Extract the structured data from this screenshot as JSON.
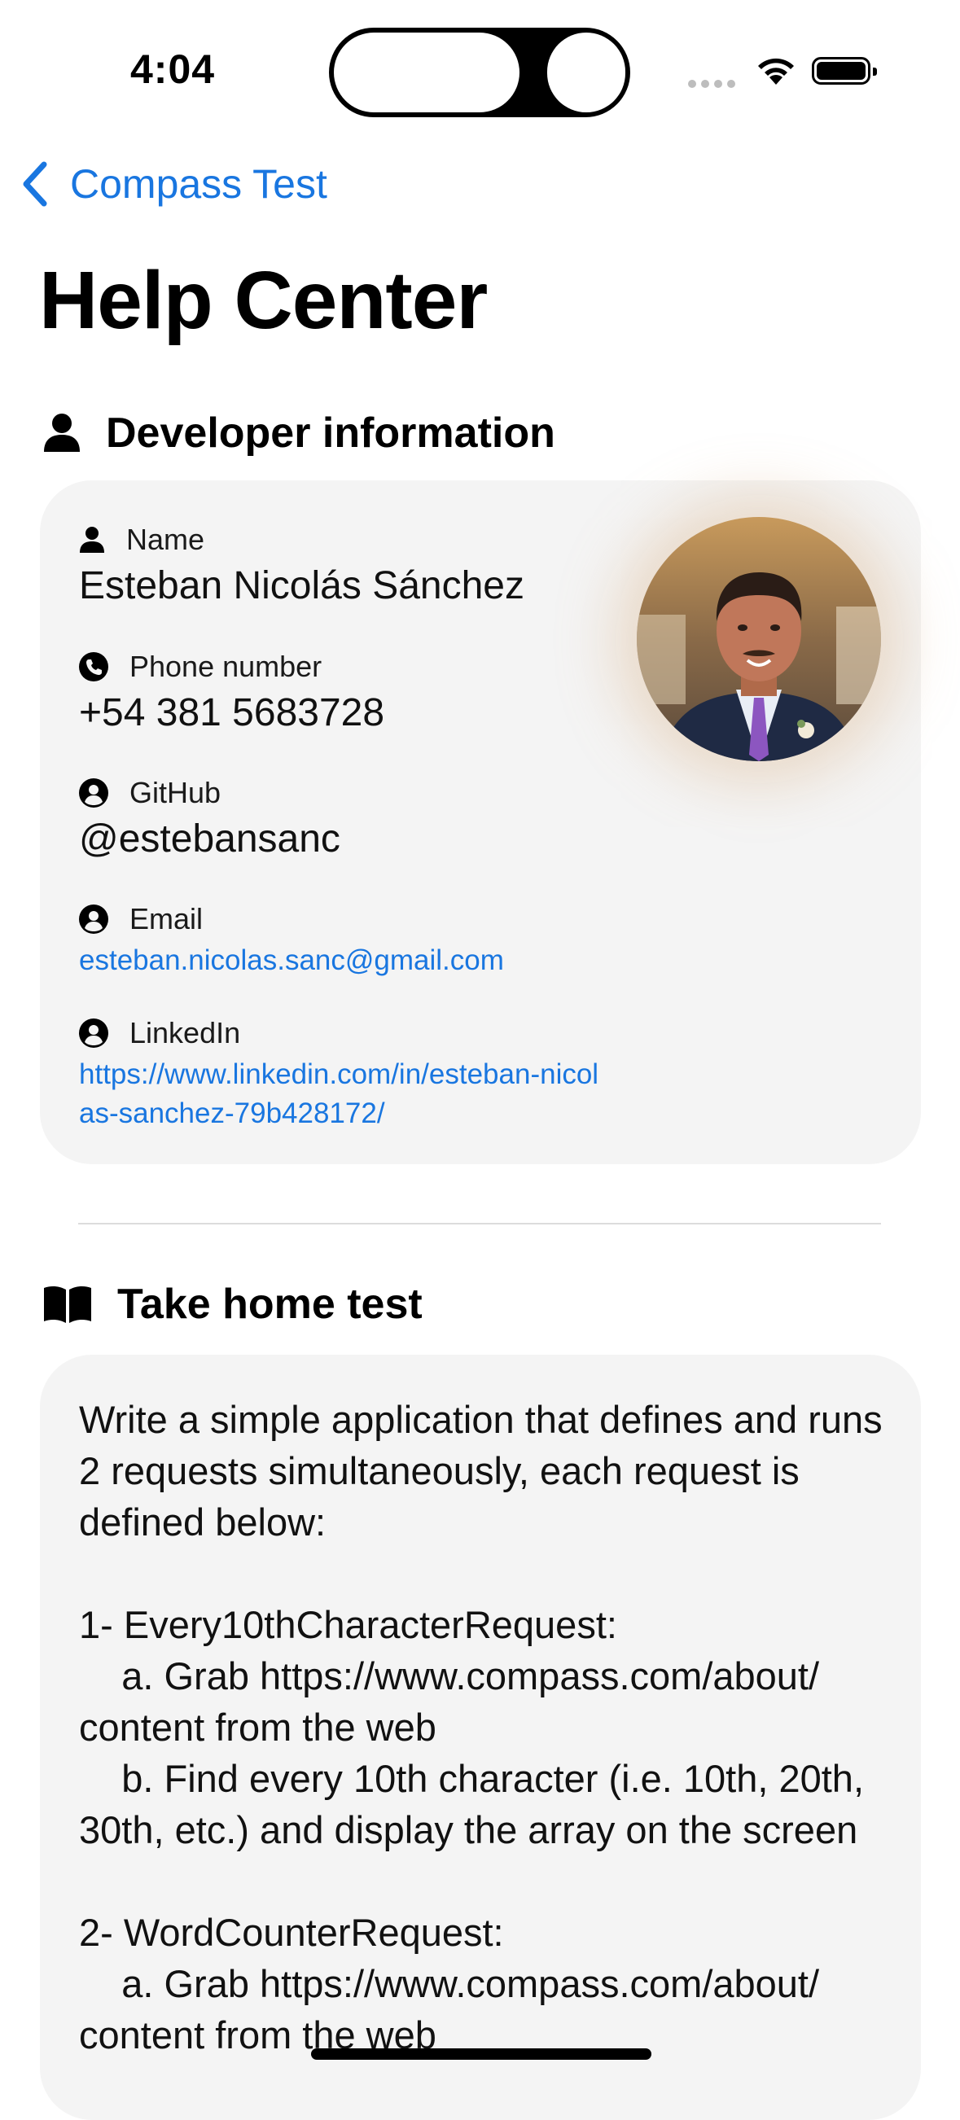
{
  "status_bar": {
    "time": "4:04"
  },
  "nav": {
    "back_label": "Compass Test"
  },
  "page": {
    "title": "Help Center"
  },
  "developer_section": {
    "header": "Developer information",
    "fields": {
      "name": {
        "label": "Name",
        "value": "Esteban Nicolás Sánchez"
      },
      "phone": {
        "label": "Phone number",
        "value": "+54 381 5683728"
      },
      "github": {
        "label": "GitHub",
        "value": "@estebansanc"
      },
      "email": {
        "label": "Email",
        "value": "esteban.nicolas.sanc@gmail.com"
      },
      "linkedin": {
        "label": "LinkedIn",
        "value": "https://www.linkedin.com/in/esteban-nicolas-sanchez-79b428172/"
      }
    }
  },
  "test_section": {
    "header": "Take home test",
    "body": "Write a simple application that defines and runs 2 requests simultaneously, each request is defined below:\n\n1- Every10thCharacterRequest:\n    a. Grab https://www.compass.com/about/ content from the web\n    b. Find every 10th character (i.e. 10th, 20th, 30th, etc.) and display the array on the screen\n\n2- WordCounterRequest:\n    a. Grab https://www.compass.com/about/ content from the web"
  },
  "colors": {
    "accent": "#1976e0",
    "card_bg": "#f4f4f4"
  }
}
